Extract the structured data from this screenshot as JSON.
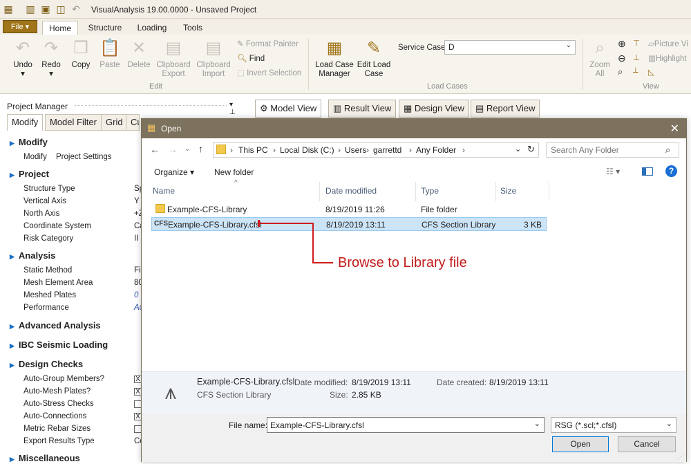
{
  "window": {
    "title": "VisualAnalysis 19.00.0000 - Unsaved Project"
  },
  "ribbon_tabs": {
    "file": "File ▾",
    "home": "Home",
    "structure": "Structure",
    "loading": "Loading",
    "tools": "Tools"
  },
  "ribbon": {
    "undo": "Undo",
    "redo": "Redo",
    "copy": "Copy",
    "paste": "Paste",
    "delete": "Delete",
    "clipboard_export_1": "Clipboard",
    "clipboard_export_2": "Export",
    "clipboard_import_1": "Clipboard",
    "clipboard_import_2": "Import",
    "format_painter": "Format Painter",
    "find": "Find",
    "invert_selection": "Invert Selection",
    "edit_group": "Edit",
    "load_case_manager_1": "Load Case",
    "load_case_manager_2": "Manager",
    "edit_load_case_1": "Edit Load",
    "edit_load_case_2": "Case",
    "service_case_label": "Service Case",
    "service_case_value": "D",
    "load_cases_group": "Load Cases",
    "zoom_all_1": "Zoom",
    "zoom_all_2": "All",
    "picture_view": "Picture Vi",
    "highlight": "Highlight",
    "view_group": "View"
  },
  "project_manager": {
    "title": "Project Manager",
    "tabs": [
      "Modify",
      "Model Filter",
      "Grid",
      "Cu"
    ],
    "sections": {
      "modify": "Modify",
      "project": "Project",
      "analysis": "Analysis",
      "advanced": "Advanced Analysis",
      "ibc": "IBC Seismic Loading",
      "design": "Design Checks",
      "misc": "Miscellaneous"
    },
    "modify_rows": {
      "label": "Modify",
      "value": "Project Settings"
    },
    "project_rows": [
      {
        "label": "Structure Type",
        "value": "Sp"
      },
      {
        "label": "Vertical Axis",
        "value": "Y"
      },
      {
        "label": "North Axis",
        "value": "+Z"
      },
      {
        "label": "Coordinate System",
        "value": "Ca"
      },
      {
        "label": "Risk Category",
        "value": "II"
      }
    ],
    "analysis_rows": [
      {
        "label": "Static Method",
        "value": "Fi"
      },
      {
        "label": "Mesh Element Area",
        "value": "80"
      },
      {
        "label": "Meshed Plates",
        "value": "0"
      },
      {
        "label": "Performance",
        "value": "Au"
      }
    ],
    "design_rows": [
      {
        "label": "Auto-Group Members?",
        "value": "X"
      },
      {
        "label": "Auto-Mesh Plates?",
        "value": "X"
      },
      {
        "label": "Auto-Stress Checks",
        "value": ""
      },
      {
        "label": "Auto-Connections",
        "value": "X"
      },
      {
        "label": "Metric Rebar Sizes",
        "value": ""
      },
      {
        "label": "Export Results Type",
        "value": "Co"
      }
    ]
  },
  "view_tabs": [
    "Model View",
    "Result View",
    "Design View",
    "Report View"
  ],
  "dialog": {
    "title": "Open",
    "breadcrumb": [
      "This PC",
      "Local Disk (C:)",
      "Users",
      "garrettd",
      "Any Folder"
    ],
    "search_placeholder": "Search Any Folder",
    "organize": "Organize ▾",
    "new_folder": "New folder",
    "columns": {
      "name": "Name",
      "date": "Date modified",
      "type": "Type",
      "size": "Size"
    },
    "files": [
      {
        "name": "Example-CFS-Library",
        "date": "8/19/2019 11:26",
        "type": "File folder",
        "size": ""
      },
      {
        "name": "Example-CFS-Library.cfsl",
        "date": "8/19/2019 13:11",
        "type": "CFS Section Library",
        "size": "3 KB"
      }
    ],
    "callout": "Browse to Library file",
    "details": {
      "name": "Example-CFS-Library.cfsl",
      "date_modified_label": "Date modified:",
      "date_modified": "8/19/2019 13:11",
      "date_created_label": "Date created:",
      "date_created": "8/19/2019 13:11",
      "type": "CFS Section Library",
      "size_label": "Size:",
      "size": "2.85 KB"
    },
    "file_name_label": "File name:",
    "file_name_value": "Example-CFS-Library.cfsl",
    "filter": "RSG (*.scl;*.cfsl)",
    "open_button": "Open",
    "cancel_button": "Cancel"
  }
}
